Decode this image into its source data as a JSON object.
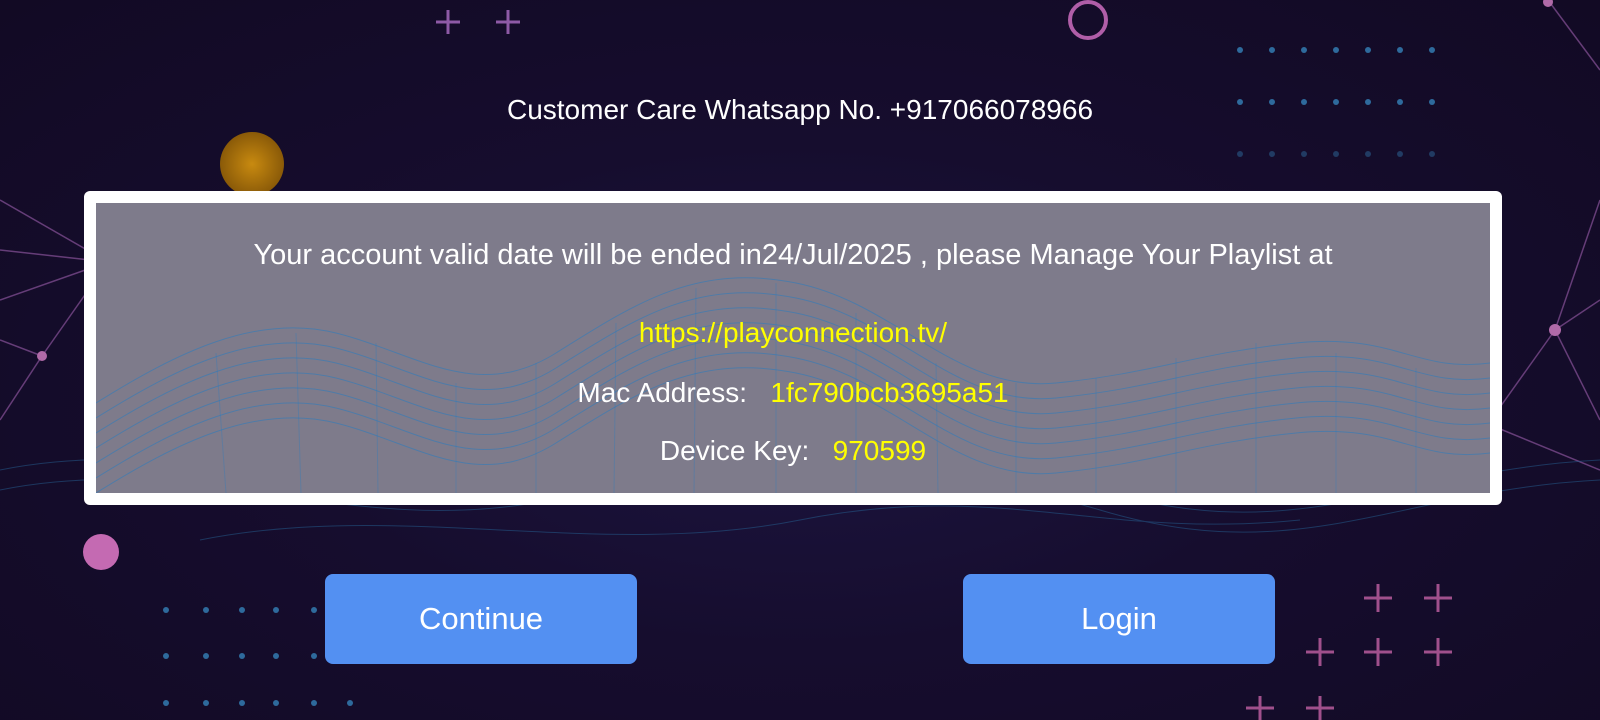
{
  "header": {
    "care_text": "Customer Care Whatsapp No. +917066078966"
  },
  "notice": {
    "message": "Your account valid date will be ended in24/Jul/2025 , please Manage Your Playlist at",
    "url": "https://playconnection.tv/",
    "mac_label": "Mac Address:",
    "mac_value": "1fc790bcb3695a51",
    "key_label": "Device Key:",
    "key_value": "970599"
  },
  "buttons": {
    "continue_label": "Continue",
    "login_label": "Login"
  },
  "colors": {
    "accent_button": "#5390f2",
    "highlight_text": "#ffff00",
    "panel_border": "#ffffff"
  }
}
